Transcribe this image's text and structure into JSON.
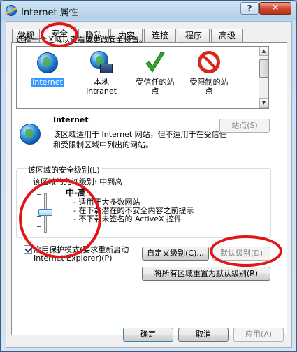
{
  "window": {
    "title": "Internet 属性",
    "help_label": "?",
    "close_label": "✕"
  },
  "tabs": [
    {
      "label": "常规",
      "active": false
    },
    {
      "label": "安全",
      "active": true
    },
    {
      "label": "隐私",
      "active": false
    },
    {
      "label": "内容",
      "active": false
    },
    {
      "label": "连接",
      "active": false
    },
    {
      "label": "程序",
      "active": false
    },
    {
      "label": "高级",
      "active": false
    }
  ],
  "security": {
    "zone_prompt": "选择一个区域以查看或更改安全设置。",
    "zones": [
      {
        "label": "Internet",
        "icon": "globe-icon",
        "selected": true
      },
      {
        "label1": "本地",
        "label2": "Intranet",
        "icon": "intranet-icon"
      },
      {
        "label1": "受信任的站",
        "label2": "点",
        "icon": "checkmark-icon"
      },
      {
        "label1": "受限制的站",
        "label2": "点",
        "icon": "no-entry-icon"
      }
    ],
    "zone_name": "Internet",
    "zone_desc": "该区域适用于 Internet 网站，但不适用于在受信任和受限制区域中列出的网站。",
    "sites_button": "站点(S)",
    "level_group_title": "该区域的安全级别(L)",
    "allowed_levels": "该区域的允许级别: 中到高",
    "level_name": "中-高",
    "level_bullets": [
      "- 适用于大多数网站",
      "- 在下载潜在的不安全内容之前提示",
      "- 不下载未签名的 ActiveX 控件"
    ],
    "protected_mode_line1": "启用保护模式(要求重新启动",
    "protected_mode_line2": "Internet Explorer)(P)",
    "protected_mode_checked": true,
    "custom_level_button": "自定义级别(C)...",
    "default_level_button": "默认级别(D)",
    "reset_all_button": "将所有区域重置为默认级别(R)"
  },
  "footer": {
    "ok": "确定",
    "cancel": "取消",
    "apply": "应用(A)"
  },
  "colors": {
    "annotation_red": "#e31515",
    "selection_blue": "#3399ff"
  }
}
